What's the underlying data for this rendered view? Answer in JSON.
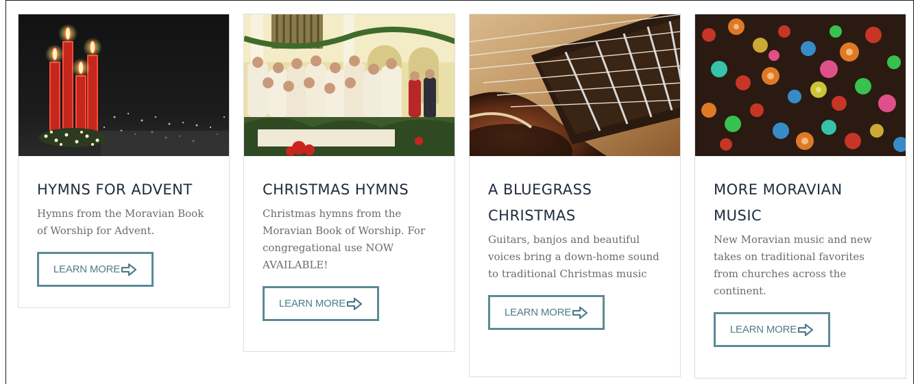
{
  "cards": [
    {
      "title": "HYMNS FOR ADVENT",
      "description": "Hymns from the Moravian Book of Worship for Advent.",
      "button_label": "LEARN MORE",
      "image": "advent-candles-night"
    },
    {
      "title": "CHRISTMAS HYMNS",
      "description": "Christmas hymns from the Moravian Book of Worship. For congregational use NOW AVAILABLE!",
      "button_label": "LEARN MORE",
      "image": "church-choir"
    },
    {
      "title": "A BLUEGRASS CHRISTMAS",
      "description": "Guitars, banjos and beautiful voices bring a down-home sound to traditional Christmas music",
      "button_label": "LEARN MORE",
      "image": "acoustic-guitar-closeup"
    },
    {
      "title": "MORE MORAVIAN MUSIC",
      "description": "New Moravian music and new takes on traditional favorites from churches across the continent.",
      "button_label": "LEARN MORE",
      "image": "bokeh-lights"
    }
  ],
  "colors": {
    "button_border": "#5b8a95",
    "button_text": "#4e7c88",
    "title": "#1e2b3a",
    "description": "#6b6b6b",
    "card_border": "#dddddd"
  },
  "icons": {
    "button_icon": "arrow-right-outline-icon"
  }
}
